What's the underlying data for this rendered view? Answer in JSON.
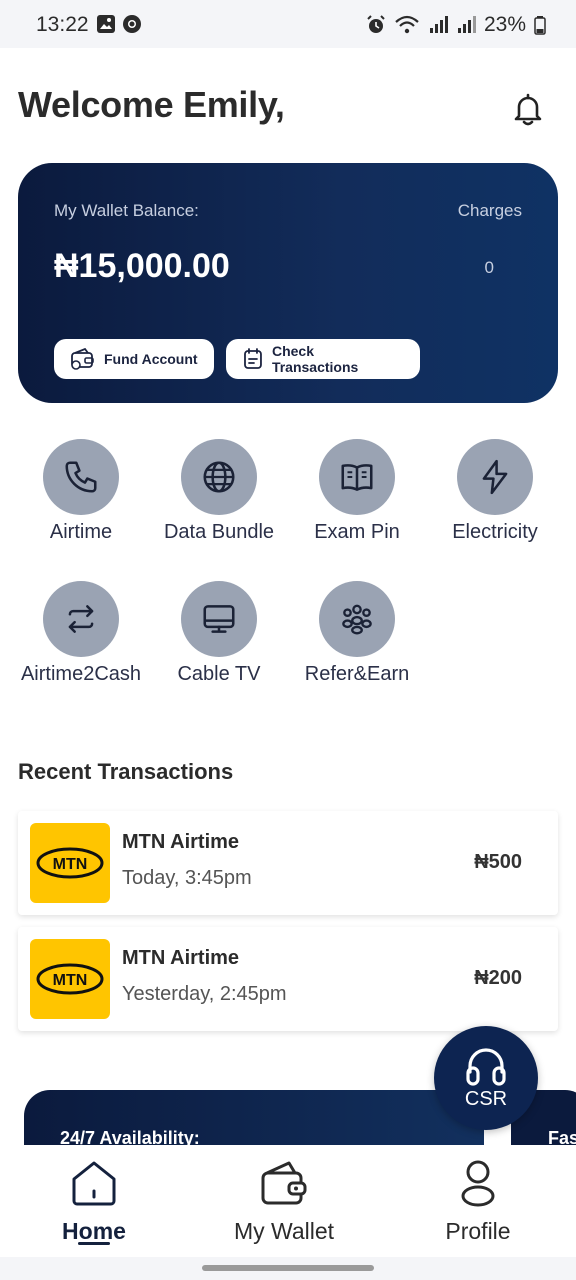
{
  "status_bar": {
    "time": "13:22",
    "battery": "23%"
  },
  "header": {
    "welcome": "Welcome Emily,"
  },
  "wallet": {
    "balance_label": "My Wallet Balance:",
    "balance": "₦15,000.00",
    "charges_label": "Charges",
    "charges": "0",
    "fund_button": "Fund Account",
    "check_button": "Check Transactions"
  },
  "services": [
    {
      "label": "Airtime",
      "icon": "phone-icon"
    },
    {
      "label": "Data Bundle",
      "icon": "globe-icon"
    },
    {
      "label": "Exam Pin",
      "icon": "book-icon"
    },
    {
      "label": "Electricity",
      "icon": "lightning-icon"
    },
    {
      "label": "Airtime2Cash",
      "icon": "swap-icon"
    },
    {
      "label": "Cable TV",
      "icon": "monitor-icon"
    },
    {
      "label": "Refer&Earn",
      "icon": "people-icon"
    }
  ],
  "recent": {
    "title": "Recent Transactions",
    "items": [
      {
        "logo": "MTN",
        "name": "MTN Airtime",
        "time": "Today, 3:45pm",
        "amount": "₦500"
      },
      {
        "logo": "MTN",
        "name": "MTN Airtime",
        "time": "Yesterday, 2:45pm",
        "amount": "₦200"
      }
    ]
  },
  "promos": [
    {
      "text": "24/7 Availability:"
    },
    {
      "text": "Fas"
    }
  ],
  "csr": {
    "label": "CSR"
  },
  "nav": {
    "items": [
      {
        "label": "Home",
        "active": true
      },
      {
        "label": "My Wallet",
        "active": false
      },
      {
        "label": "Profile",
        "active": false
      }
    ]
  },
  "colors": {
    "primary": "#0b1a3d",
    "service_circle": "#9aa3b3",
    "mtn_yellow": "#ffc500"
  }
}
